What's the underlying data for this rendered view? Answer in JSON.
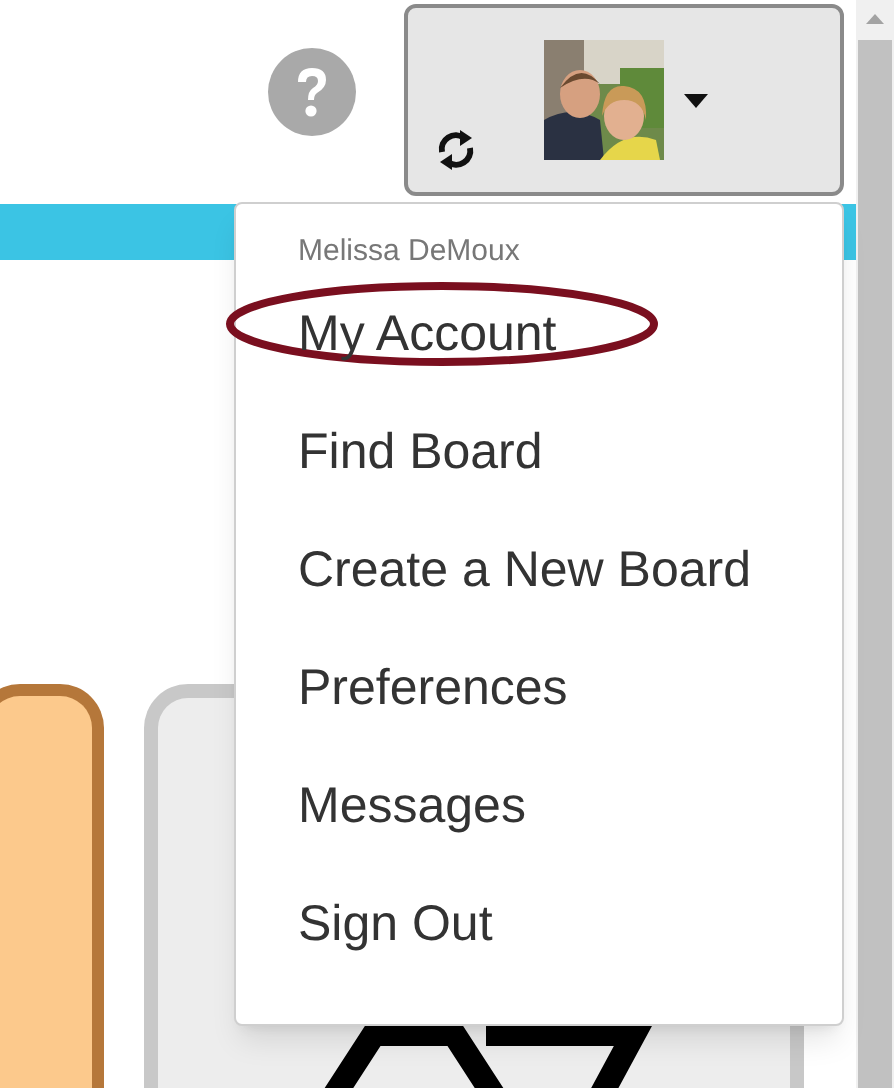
{
  "user_menu": {
    "user_name": "Melissa DeMoux",
    "items": [
      {
        "label": "My Account",
        "circled": true
      },
      {
        "label": "Find Board",
        "circled": false
      },
      {
        "label": "Create a New Board",
        "circled": false
      },
      {
        "label": "Preferences",
        "circled": false
      },
      {
        "label": "Messages",
        "circled": false
      },
      {
        "label": "Sign Out",
        "circled": false
      }
    ]
  },
  "profile_button": {
    "expanded": true
  }
}
